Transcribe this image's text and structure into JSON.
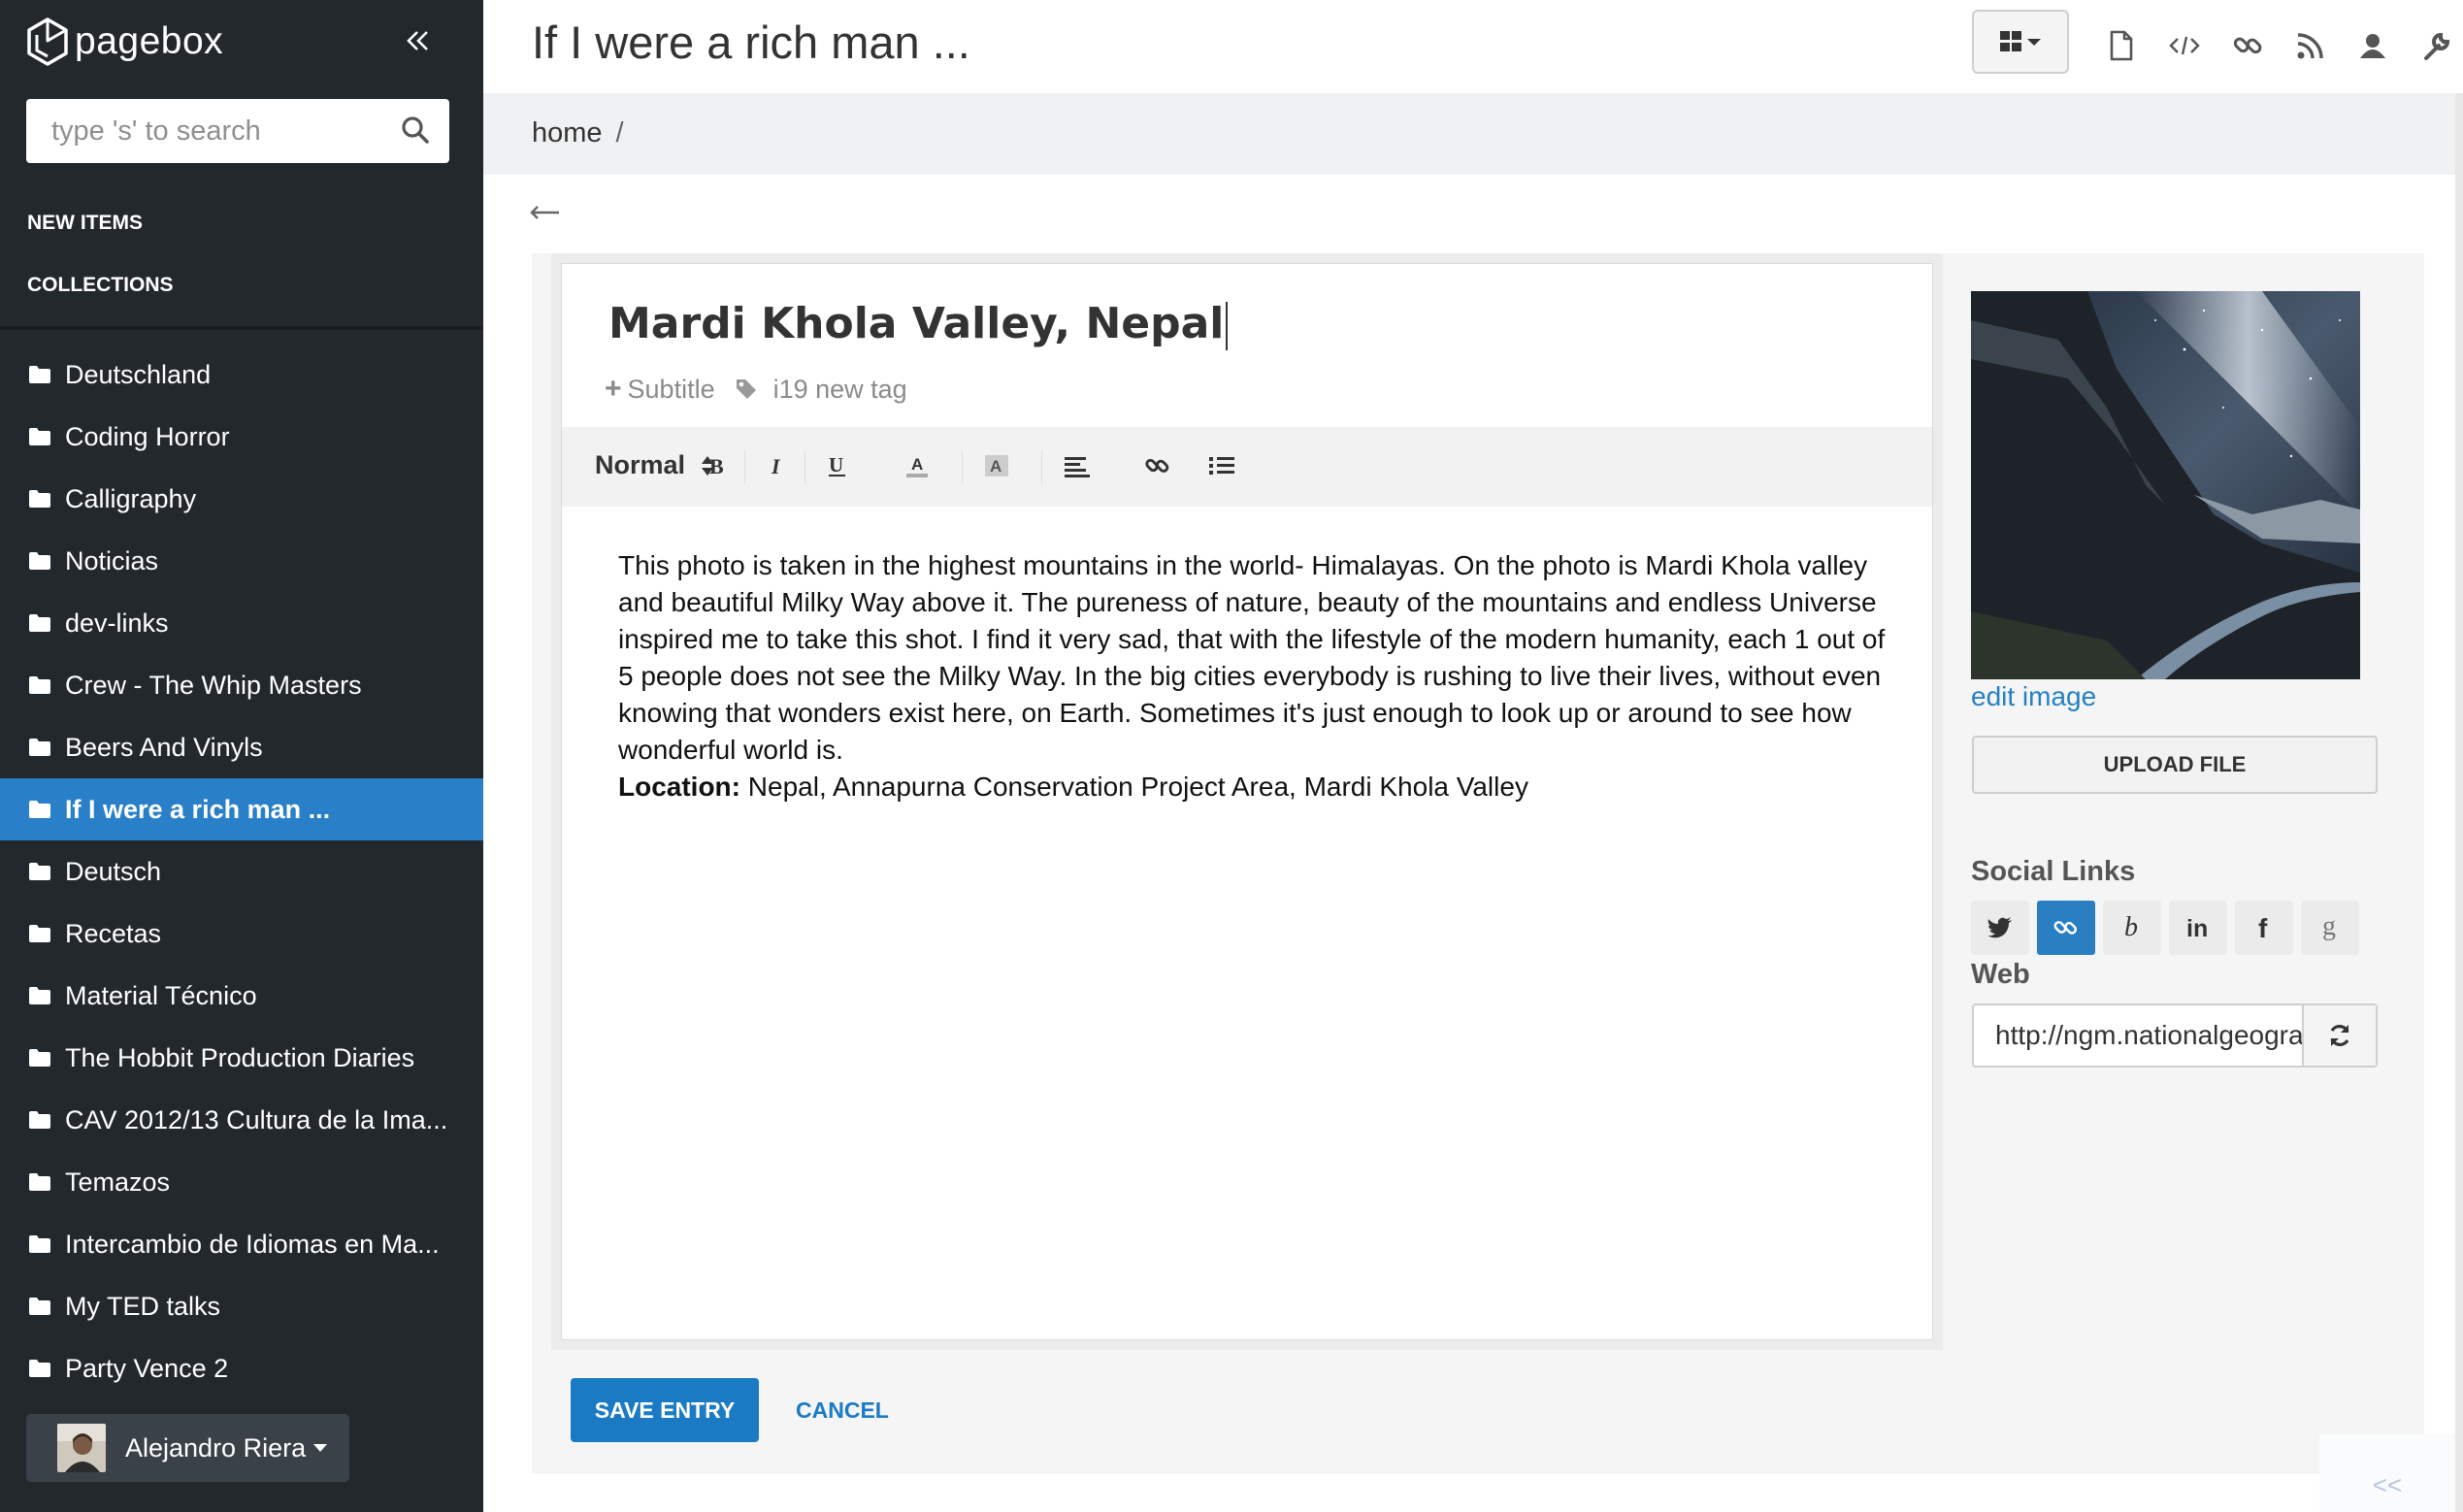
{
  "app": {
    "name": "pagebox"
  },
  "search": {
    "placeholder": "type 's' to search"
  },
  "nav": {
    "new_items": "NEW ITEMS",
    "collections": "COLLECTIONS"
  },
  "sidebar": {
    "items": [
      {
        "label": "Deutschland"
      },
      {
        "label": "Coding Horror"
      },
      {
        "label": "Calligraphy"
      },
      {
        "label": "Noticias"
      },
      {
        "label": "dev-links"
      },
      {
        "label": "Crew - The Whip Masters"
      },
      {
        "label": "Beers And Vinyls"
      },
      {
        "label": "If I were a rich man ...",
        "active": true
      },
      {
        "label": "Deutsch"
      },
      {
        "label": "Recetas"
      },
      {
        "label": "Material Técnico"
      },
      {
        "label": "The Hobbit Production Diaries"
      },
      {
        "label": "CAV 2012/13 Cultura de la Ima..."
      },
      {
        "label": "Temazos"
      },
      {
        "label": "Intercambio de Idiomas en Ma..."
      },
      {
        "label": "My TED talks"
      },
      {
        "label": "Party Vence 2"
      }
    ],
    "user": {
      "name": "Alejandro Riera"
    }
  },
  "header": {
    "title": "If I were a rich man ..."
  },
  "breadcrumb": {
    "home": "home",
    "separator": "/"
  },
  "entry": {
    "title": "Mardi Khola Valley, Nepal",
    "subtitle_label": "Subtitle",
    "tag_placeholder": "i19 new tag",
    "format_select": "Normal",
    "body": "This photo is taken in the highest mountains in the world- Himalayas. On the photo is Mardi Khola valley and beautiful Milky Way above it. The pureness of nature, beauty of the mountains and endless Universe inspired me to take this shot. I find it very sad, that with the lifestyle of the modern humanity, each 1 out of 5 people does not see the Milky Way. In the big cities everybody is rushing to live their lives, without even knowing that wonders exist here, on Earth. Sometimes it's just enough to look up or around to see how wonderful world is.",
    "location_label": "Location:",
    "location_value": "Nepal, Annapurna Conservation Project Area, Mardi Khola Valley"
  },
  "media": {
    "edit_image": "edit image",
    "upload_button": "UPLOAD FILE"
  },
  "social": {
    "heading": "Social Links",
    "icons": [
      "twitter-icon",
      "link-icon",
      "behance-icon",
      "linkedin-icon",
      "facebook-icon",
      "google-icon"
    ],
    "active": "link-icon",
    "web_label": "Web",
    "web_value": "http://ngm.nationalgeographic.com/"
  },
  "actions": {
    "save": "SAVE ENTRY",
    "cancel": "CANCEL"
  },
  "corner_toggle": "<<",
  "colors": {
    "sidebar_bg": "#23282d",
    "accent": "#2a7fc3",
    "active_item": "#2980c9"
  }
}
